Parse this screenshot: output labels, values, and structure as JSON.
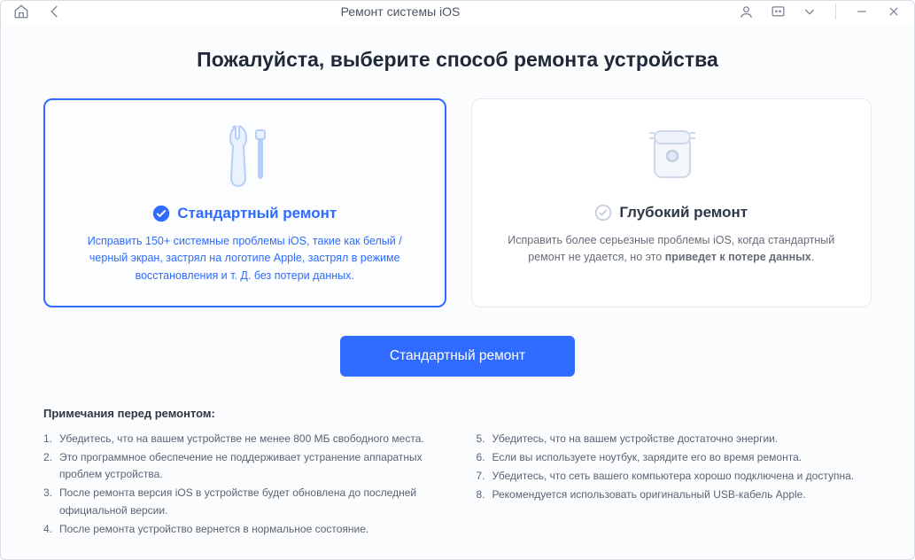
{
  "titlebar": {
    "title": "Ремонт системы iOS"
  },
  "page": {
    "heading": "Пожалуйста, выберите способ ремонта устройства"
  },
  "cards": {
    "standard": {
      "title": "Стандартный ремонт",
      "desc": "Исправить 150+ системные проблемы iOS, такие как белый / черный экран, застрял на логотипе Apple, застрял в режиме восстановления и т. Д. без потери данных."
    },
    "deep": {
      "title": "Глубокий ремонт",
      "desc_prefix": "Исправить более серьезные проблемы iOS, когда стандартный ремонт не удается, но это ",
      "desc_bold": "приведет к потере данных",
      "desc_suffix": "."
    }
  },
  "cta": {
    "label": "Стандартный ремонт"
  },
  "notes": {
    "heading": "Примечания перед ремонтом:",
    "left": [
      "Убедитесь, что на вашем устройстве не менее 800 МБ свободного места.",
      "Это программное обеспечение не поддерживает устранение аппаратных проблем устройства.",
      "После ремонта версия iOS в устройстве будет обновлена до последней официальной версии.",
      "После ремонта устройство вернется в нормальное состояние."
    ],
    "right": [
      "Убедитесь, что на вашем устройстве достаточно энергии.",
      "Если вы используете ноутбук, зарядите его во время ремонта.",
      "Убедитесь, что сеть вашего компьютера хорошо подключена и доступна.",
      "Рекомендуется использовать оригинальный USB-кабель Apple."
    ]
  }
}
